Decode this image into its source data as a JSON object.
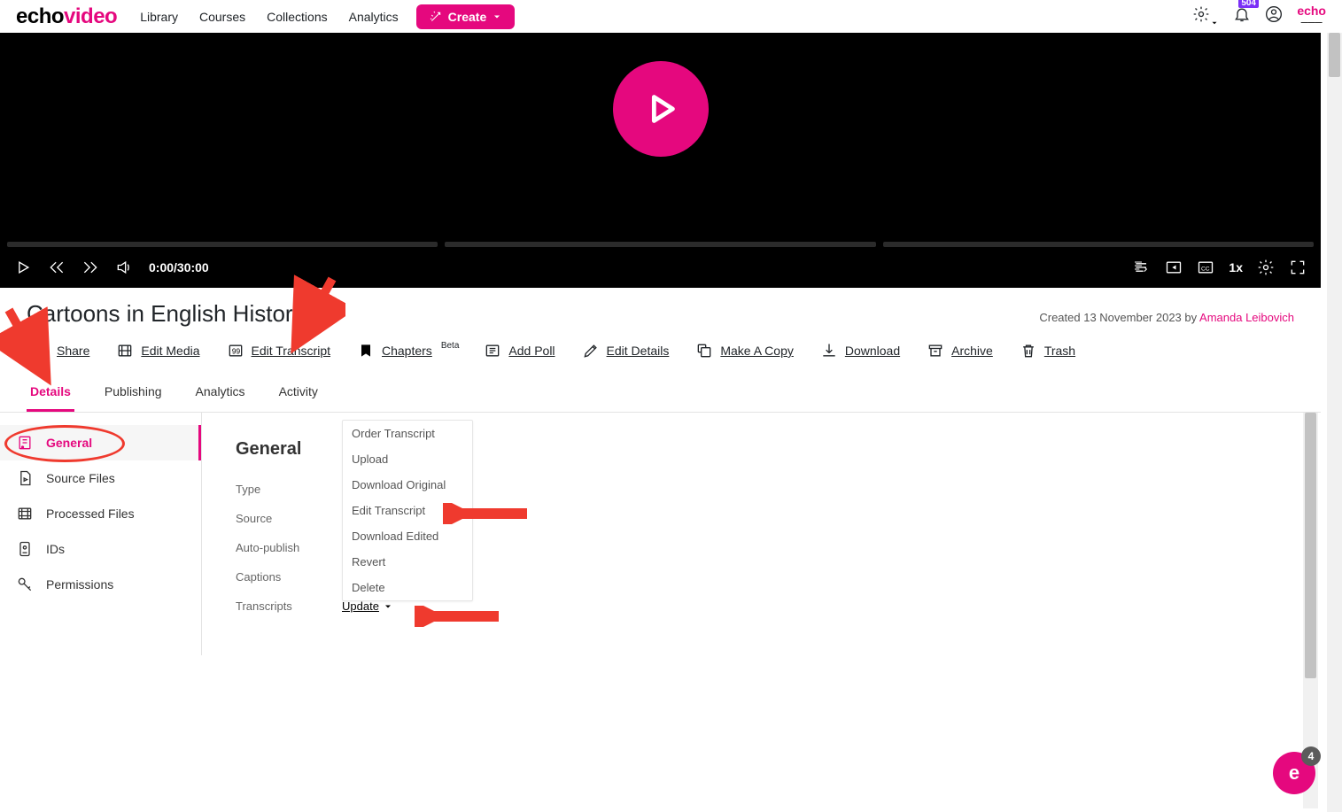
{
  "nav": {
    "library": "Library",
    "courses": "Courses",
    "collections": "Collections",
    "analytics": "Analytics",
    "create": "Create",
    "badge": "504"
  },
  "logo": {
    "a": "echo",
    "b": "video"
  },
  "player": {
    "time": "0:00/30:00",
    "speed": "1x"
  },
  "title": "Cartoons in English History",
  "meta": {
    "prefix": "Created 13 November 2023 by ",
    "author": "Amanda Leibovich"
  },
  "toolbar": {
    "share": "Share",
    "editmedia": "Edit Media",
    "edittranscript": "Edit Transcript",
    "chapters": "Chapters",
    "chapters_sup": "Beta",
    "addpoll": "Add Poll",
    "editdetails": "Edit Details",
    "copy": "Make A Copy",
    "download": "Download",
    "archive": "Archive",
    "trash": "Trash"
  },
  "tabs": {
    "details": "Details",
    "publishing": "Publishing",
    "analytics": "Analytics",
    "activity": "Activity"
  },
  "side": {
    "general": "General",
    "source": "Source Files",
    "processed": "Processed Files",
    "ids": "IDs",
    "permissions": "Permissions"
  },
  "content": {
    "heading": "General",
    "type": "Type",
    "source": "Source",
    "autopub": "Auto-publish",
    "captions": "Captions",
    "transcripts": "Transcripts",
    "update": "Update"
  },
  "menu": {
    "order": "Order Transcript",
    "upload": "Upload",
    "dlorig": "Download Original",
    "edit": "Edit Transcript",
    "dledit": "Download Edited",
    "revert": "Revert",
    "delete": "Delete"
  },
  "chat": {
    "letter": "e",
    "count": "4"
  }
}
